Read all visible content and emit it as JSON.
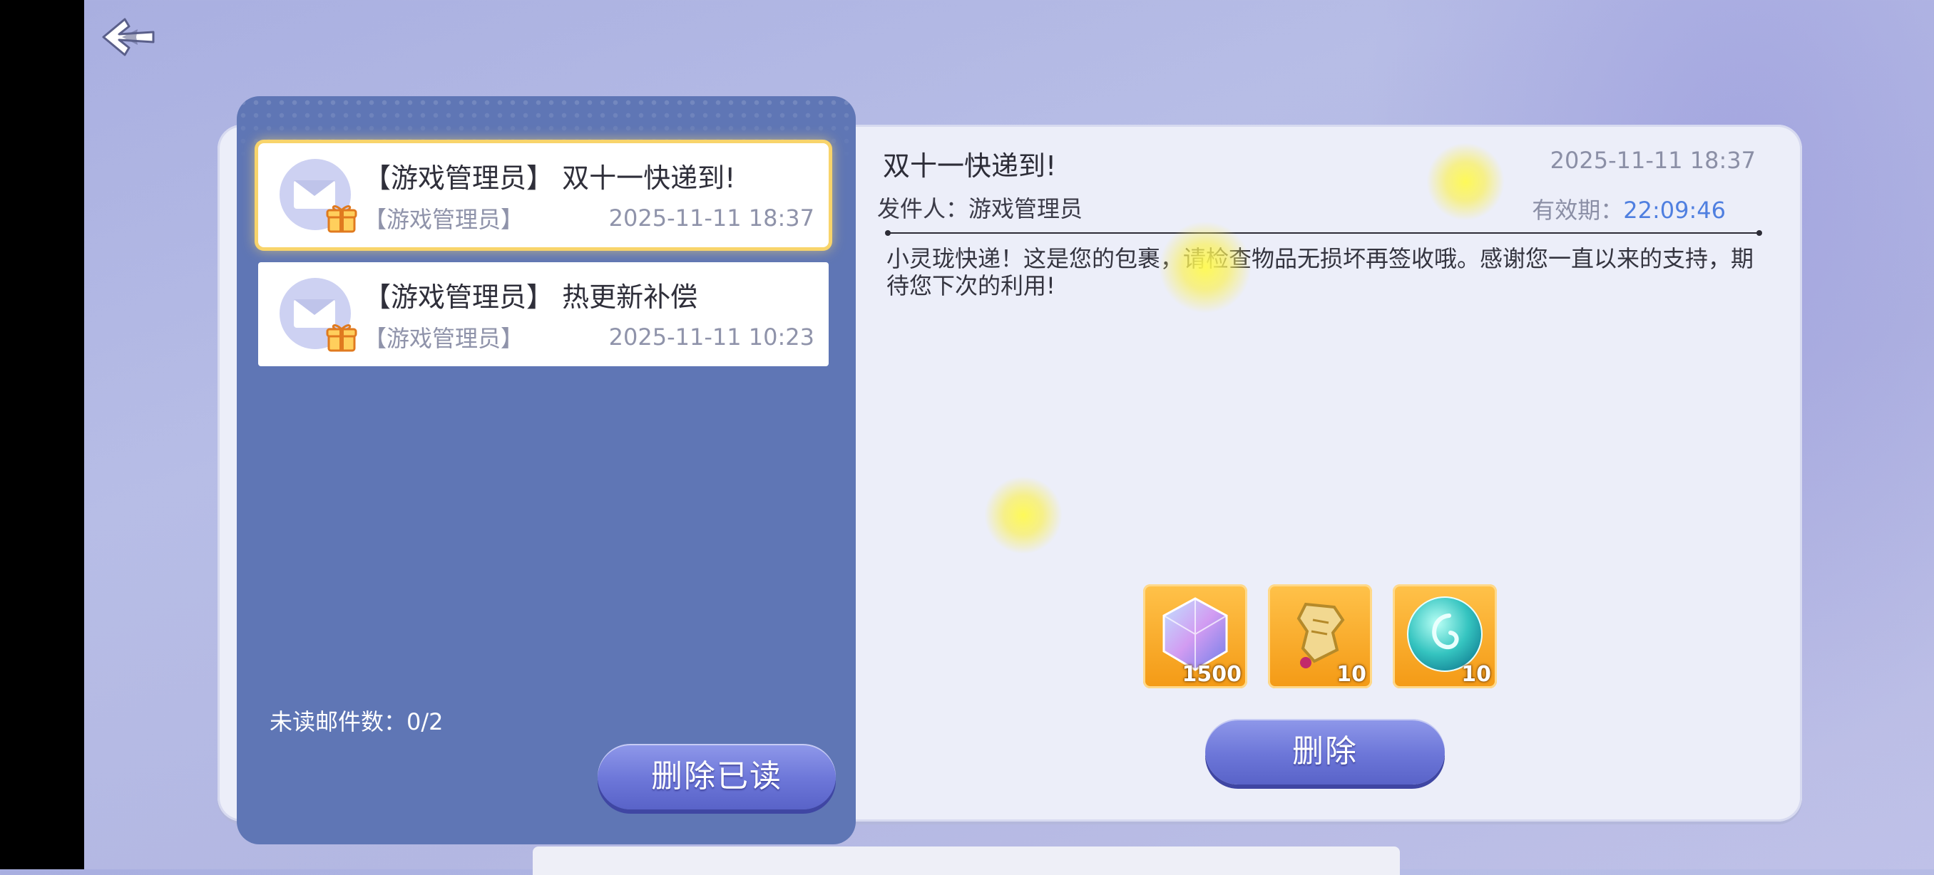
{
  "mailbox": {
    "items": [
      {
        "title": "【游戏管理员】 双十一快递到!",
        "sender": "【游戏管理员】",
        "time": "2025-11-11 18:37"
      },
      {
        "title": "【游戏管理员】 热更新补偿",
        "sender": "【游戏管理员】",
        "time": "2025-11-11 10:23"
      }
    ],
    "unread_label": "未读邮件数：0/2",
    "delete_read_label": "删除已读"
  },
  "detail": {
    "title": "双十一快递到!",
    "date": "2025-11-11 18:37",
    "sender_label": "发件人：游戏管理员",
    "expiry_label": "有效期：",
    "expiry_value": "22:09:46",
    "body": "小灵珑快递！这是您的包裹，请检查物品无损坏再签收哦。感谢您一直以来的支持，期待您下次的利用!",
    "rewards": [
      {
        "icon": "crystal-cube-icon",
        "count": "1500"
      },
      {
        "icon": "golden-scroll-icon",
        "count": "10"
      },
      {
        "icon": "spirit-orb-icon",
        "count": "10"
      }
    ],
    "delete_label": "删除"
  },
  "colors": {
    "panel": "#5f76b5",
    "selected_border": "#f8d46b",
    "reward_bg": "#f49a15",
    "expiry_value": "#4f7fe0",
    "button": "#6c76d8"
  }
}
